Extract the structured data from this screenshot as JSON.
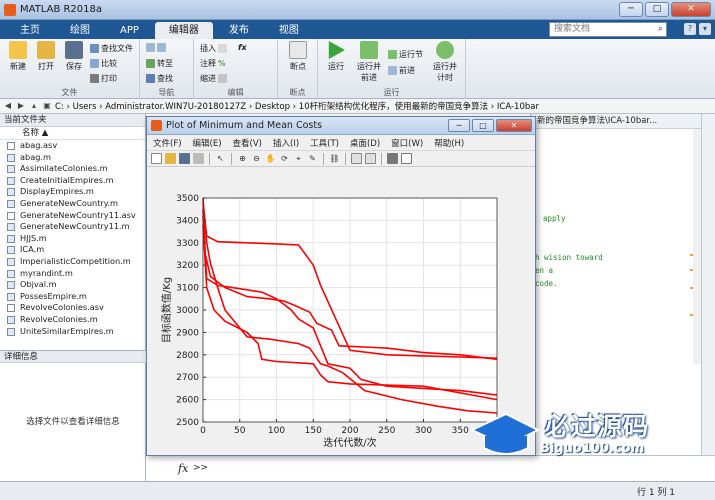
{
  "app": {
    "title": "MATLAB R2018a"
  },
  "tabs": [
    "主页",
    "绘图",
    "APP",
    "编辑器",
    "发布",
    "视图"
  ],
  "search": {
    "placeholder": "搜索文档"
  },
  "ribbon": {
    "file": {
      "new": "新建",
      "open": "打开",
      "save": "保存",
      "find_files": "查找文件",
      "compare": "比较",
      "print": "打印",
      "group": "文件"
    },
    "nav": {
      "goto": "转至",
      "find": "查找",
      "group": "导航"
    },
    "edit": {
      "insert": "插入",
      "comment": "注释",
      "indent": "缩进",
      "fx": "fx",
      "group": "编辑"
    },
    "breakpoints": {
      "label": "断点",
      "group": "断点"
    },
    "run": {
      "run": "运行",
      "run_advance": "运行并前进",
      "run_section": "运行节",
      "advance": "前进",
      "run_time": "运行并计时",
      "group": "运行"
    }
  },
  "address": {
    "path": "C: › Users › Administrator.WIN7U-20180127Z › Desktop › 10杆桁架结构优化程序，使用最新的帝国竞争算法 › ICA-10bar"
  },
  "current_folder": {
    "header": "当前文件夹",
    "col_name": "名称 ▲",
    "files": [
      "abag.asv",
      "abag.m",
      "AssimilateColonies.m",
      "CreateInitialEmpires.m",
      "DisplayEmpires.m",
      "GenerateNewCountry.m",
      "GenerateNewCountry11.asv",
      "GenerateNewCountry11.m",
      "HJJS.m",
      "ICA.m",
      "ImperialisticCompetition.m",
      "myrandint.m",
      "Objval.m",
      "PossesEmpire.m",
      "RevolveColonies.asv",
      "RevolveColonies.m",
      "UniteSimilarEmpires.m"
    ]
  },
  "details": {
    "header": "详细信息",
    "hint": "选择文件以查看详细信息"
  },
  "editor": {
    "tab": "新的帝国竞争算法\\ICA-10bar...",
    "code_lines": [
      "apply",
      "h wision toward",
      "en a",
      " code."
    ]
  },
  "command": {
    "fx": "fx",
    "prompt": ">>"
  },
  "status": {
    "position": "行 1   列 1"
  },
  "figure": {
    "title": "Plot of Minimum and Mean Costs",
    "menu": [
      "文件(F)",
      "编辑(E)",
      "查看(V)",
      "插入(I)",
      "工具(T)",
      "桌面(D)",
      "窗口(W)",
      "帮助(H)"
    ]
  },
  "watermark": {
    "main": "必过源码",
    "sub": "Biguo100.com"
  },
  "chart_data": {
    "type": "line",
    "title": "",
    "xlabel": "迭代代数/次",
    "ylabel": "目标函数值/Kg",
    "xlim": [
      0,
      400
    ],
    "ylim": [
      2500,
      3500
    ],
    "xticks": [
      0,
      50,
      100,
      150,
      200,
      250,
      300,
      350
    ],
    "yticks": [
      2500,
      2600,
      2700,
      2800,
      2900,
      3000,
      3100,
      3200,
      3300,
      3400,
      3500
    ],
    "grid": true,
    "color": "#ff0000",
    "series": [
      {
        "x": [
          0,
          5,
          20,
          60,
          100,
          130,
          150,
          160,
          200,
          250,
          300,
          350,
          400
        ],
        "y": [
          3480,
          3330,
          3305,
          3300,
          3295,
          3290,
          3200,
          3110,
          2820,
          2800,
          2795,
          2790,
          2785
        ]
      },
      {
        "x": [
          0,
          3,
          10,
          30,
          60,
          90,
          110,
          125,
          145,
          155,
          175,
          185,
          250,
          300,
          350,
          400
        ],
        "y": [
          3450,
          3250,
          3150,
          3100,
          3060,
          3050,
          3040,
          3020,
          2990,
          2940,
          2910,
          2840,
          2830,
          2810,
          2800,
          2780
        ]
      },
      {
        "x": [
          0,
          5,
          20,
          40,
          80,
          100,
          120,
          130,
          150,
          170,
          200,
          215,
          250,
          300,
          350,
          400
        ],
        "y": [
          3420,
          3140,
          3110,
          3100,
          3080,
          3050,
          3000,
          2960,
          2920,
          2760,
          2740,
          2690,
          2660,
          2650,
          2640,
          2620
        ]
      },
      {
        "x": [
          0,
          2,
          5,
          10,
          20,
          30,
          60,
          90,
          130,
          145,
          160,
          170,
          190,
          220,
          270,
          320,
          360,
          400
        ],
        "y": [
          3500,
          3400,
          3300,
          3210,
          3100,
          3000,
          2880,
          2870,
          2850,
          2830,
          2760,
          2750,
          2720,
          2640,
          2600,
          2570,
          2550,
          2540
        ]
      },
      {
        "x": [
          0,
          5,
          15,
          30,
          60,
          75,
          80,
          100,
          150,
          160,
          170,
          200,
          300,
          400
        ],
        "y": [
          3380,
          3100,
          3000,
          2950,
          2900,
          2850,
          2780,
          2770,
          2760,
          2710,
          2680,
          2670,
          2660,
          2600
        ]
      }
    ]
  }
}
